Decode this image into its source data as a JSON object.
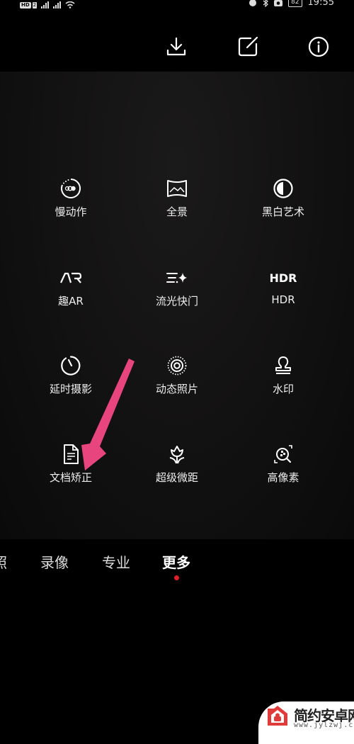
{
  "status_bar": {
    "network_badge": "HD",
    "sim_badge": "2",
    "battery": "82",
    "time": "19:55"
  },
  "toolbar": {
    "buttons": [
      {
        "icon": "download-icon"
      },
      {
        "icon": "edit-icon"
      },
      {
        "icon": "info-icon"
      }
    ]
  },
  "modes": [
    {
      "label": "慢动作",
      "icon": "slow-motion-icon"
    },
    {
      "label": "全景",
      "icon": "panorama-icon"
    },
    {
      "label": "黑白艺术",
      "icon": "monochrome-icon"
    },
    {
      "label": "趣AR",
      "icon": "ar-icon",
      "icon_text": "AR"
    },
    {
      "label": "流光快门",
      "icon": "light-painting-icon"
    },
    {
      "label": "HDR",
      "icon": "hdr-icon",
      "icon_text": "HDR"
    },
    {
      "label": "延时摄影",
      "icon": "timelapse-icon"
    },
    {
      "label": "动态照片",
      "icon": "moving-picture-icon"
    },
    {
      "label": "水印",
      "icon": "watermark-stamp-icon"
    },
    {
      "label": "文档矫正",
      "icon": "document-icon"
    },
    {
      "label": "超级微距",
      "icon": "macro-flower-icon"
    },
    {
      "label": "高像素",
      "icon": "high-resolution-icon"
    }
  ],
  "tabs": [
    {
      "label": "照",
      "active": false
    },
    {
      "label": "录像",
      "active": false
    },
    {
      "label": "专业",
      "active": false
    },
    {
      "label": "更多",
      "active": true
    }
  ],
  "colors": {
    "active_dot": "#e0202a",
    "annotation_arrow": "#e8457f",
    "watermark_red": "#e03a3a"
  },
  "watermark": {
    "title": "简约安卓网",
    "url": "www.jylzwj.com"
  }
}
